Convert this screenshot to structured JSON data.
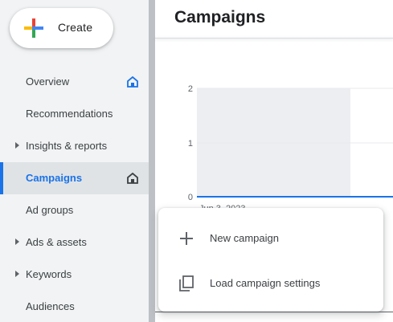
{
  "sidebar": {
    "create_label": "Create",
    "items": [
      {
        "label": "Overview",
        "has_caret": false,
        "icon": "home-icon",
        "active": false
      },
      {
        "label": "Recommendations",
        "has_caret": false,
        "icon": "",
        "active": false
      },
      {
        "label": "Insights & reports",
        "has_caret": true,
        "icon": "",
        "active": false
      },
      {
        "label": "Campaigns",
        "has_caret": false,
        "icon": "home-icon",
        "active": true
      },
      {
        "label": "Ad groups",
        "has_caret": false,
        "icon": "",
        "active": false
      },
      {
        "label": "Ads & assets",
        "has_caret": true,
        "icon": "",
        "active": false
      },
      {
        "label": "Keywords",
        "has_caret": true,
        "icon": "",
        "active": false
      },
      {
        "label": "Audiences",
        "has_caret": false,
        "icon": "",
        "active": false
      }
    ]
  },
  "main": {
    "title": "Campaigns"
  },
  "chart_data": {
    "type": "line",
    "y_ticks": [
      "2",
      "1",
      "0"
    ],
    "ylim": [
      0,
      2
    ],
    "x_label_partial": "Jun 3, 2023",
    "series": [
      {
        "values": [
          0,
          0
        ]
      }
    ]
  },
  "menu": {
    "items": [
      {
        "label": "New campaign",
        "icon": "plus-icon"
      },
      {
        "label": "Load campaign settings",
        "icon": "copy-icon"
      }
    ]
  },
  "colors": {
    "accent": "#1a73e8",
    "sidebar_bg": "#f1f3f4",
    "active_bg": "#e0e3e6"
  }
}
